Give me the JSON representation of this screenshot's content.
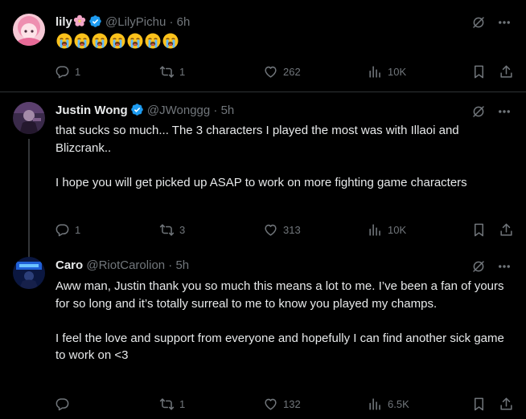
{
  "colors": {
    "background": "#000000",
    "text": "#e7e9ea",
    "muted": "#71767b",
    "verified": "#1d9bf0",
    "divider": "#2f3336"
  },
  "tweets": [
    {
      "name": "lily",
      "verified": true,
      "has_flower": true,
      "handle": "@LilyPichu",
      "dot": "·",
      "time": "6h",
      "emoji_row": [
        "crying-face",
        "crying-face",
        "crying-face",
        "crying-face",
        "crying-face",
        "crying-face",
        "crying-face"
      ],
      "paragraphs": [],
      "stats": {
        "replies": "1",
        "reposts": "1",
        "likes": "262",
        "views": "10K"
      }
    },
    {
      "name": "Justin Wong",
      "verified": true,
      "handle": "@JWonggg",
      "dot": "·",
      "time": "5h",
      "paragraphs": [
        "that sucks so much... The 3 characters I played the most was with Illaoi and Blizcrank..",
        "I hope you will get picked up ASAP to work on more fighting game characters"
      ],
      "stats": {
        "replies": "1",
        "reposts": "3",
        "likes": "313",
        "views": "10K"
      }
    },
    {
      "name": "Caro",
      "verified": false,
      "handle": "@RiotCarolion",
      "dot": "·",
      "time": "5h",
      "paragraphs": [
        "Aww man, Justin thank you so much this means a lot to me. I’ve been a fan of yours for so long and it’s totally surreal to me to know you played my champs.",
        "I feel the love and support from everyone and hopefully I can find another sick game to work on <3"
      ],
      "stats": {
        "replies": "",
        "reposts": "1",
        "likes": "132",
        "views": "6.5K"
      }
    }
  ]
}
